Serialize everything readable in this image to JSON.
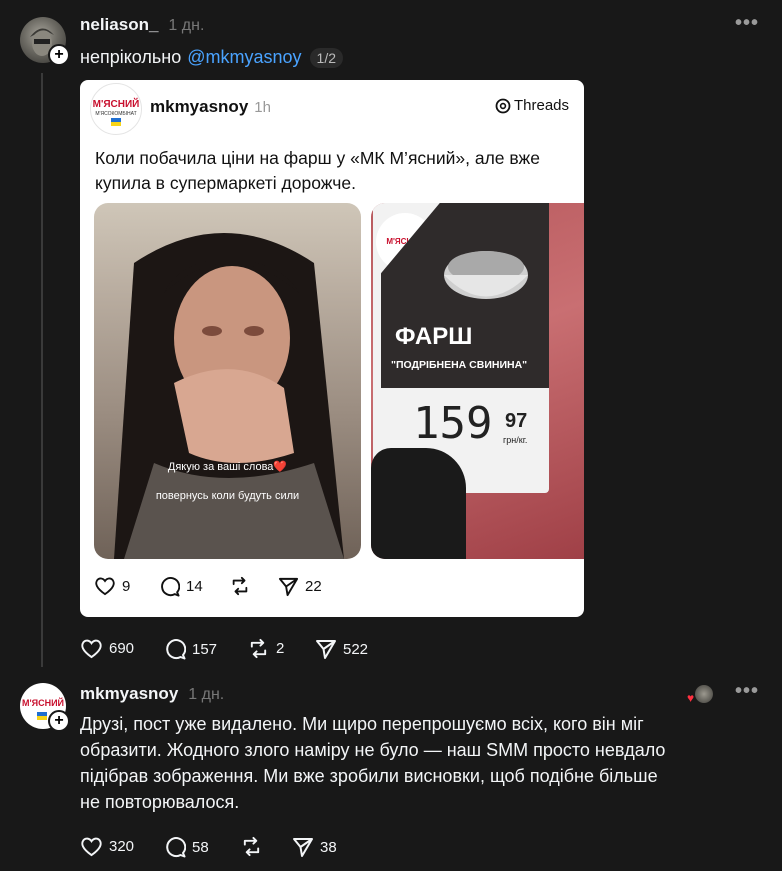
{
  "post": {
    "username": "neliason_",
    "time": "1 дн.",
    "text": "непрікольно",
    "mention": "@mkmyasnoy",
    "counter": "1/2",
    "actions": {
      "likes": "690",
      "comments": "157",
      "reposts": "2",
      "shares": "522"
    }
  },
  "embedded": {
    "username": "mkmyasnoy",
    "time": "1h",
    "brand": "Threads",
    "text_line1": "Коли побачила ціни на фарш у «МК М’ясний», але вже",
    "text_line2": "купила в супермаркеті дорожче.",
    "logo_text_main": "М'ЯСНИЙ",
    "logo_text_sub": "М'ЯСОКОМБІНАТ",
    "image1": {
      "caption1": "Дякую за ваші слова❤️",
      "caption2": "повернусь коли будуть сили"
    },
    "image2": {
      "label_title": "ФАРШ",
      "label_sub": "\"ПОДРІБНЕНА СВИНИНА\"",
      "price_main": "159",
      "price_cents": "97",
      "price_unit": "грн/кг."
    },
    "actions": {
      "likes": "9",
      "comments": "14",
      "shares": "22"
    }
  },
  "reply": {
    "username": "mkmyasnoy",
    "time": "1 дн.",
    "line1": "Друзі, пост уже видалено. Ми щиро перепрошуємо всіх, кого він міг",
    "line2": "образити. Жодного злого наміру не було — наш SMM просто невдало",
    "line3": "підібрав зображення. Ми вже зробили висновки, щоб подібне більше",
    "line4": "не повторювалося.",
    "actions": {
      "likes": "320",
      "comments": "58",
      "shares": "38"
    }
  },
  "colors": {
    "background": "#181818",
    "mention": "#4aa3ff",
    "text": "#f3f5f7",
    "muted": "#777777",
    "logo_red": "#c8102e"
  }
}
